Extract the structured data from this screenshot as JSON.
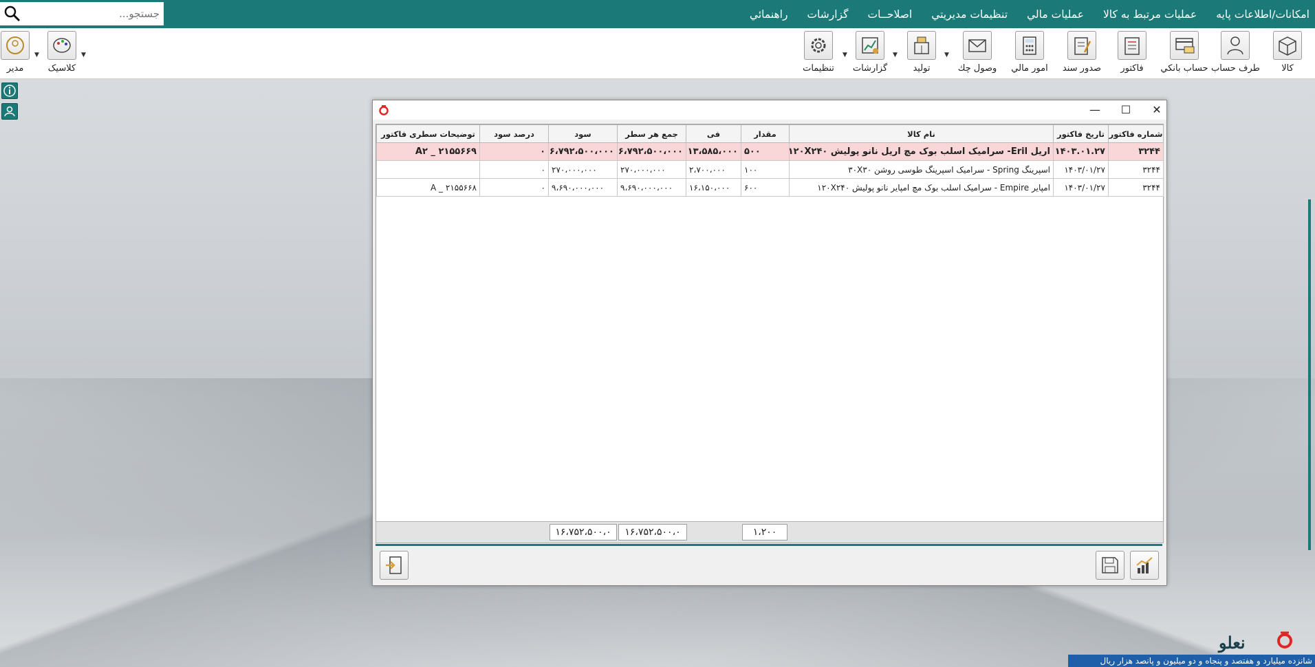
{
  "menu": {
    "items": [
      "امکانات/اطلاعات پایه",
      "عملیات مرتبط به کالا",
      "عمليات مالي",
      "تنظيمات مديريتي",
      "اصلاحــات",
      "گزارشات",
      "راهنمائي"
    ],
    "search_placeholder": "جستجو..."
  },
  "toolbar": {
    "items": [
      "کالا",
      "طرف حساب",
      "حساب بانکي",
      "فاکتور",
      "صدور سند",
      "امور مالي",
      "وصول چك",
      "توليد",
      "گزارشات",
      "تنظيمات"
    ],
    "right_items": [
      "کلاسیک",
      "مدیر"
    ]
  },
  "window": {
    "columns": [
      "شماره فاکتور",
      "تاريخ فاکتور",
      "نام کالا",
      "مقدار",
      "فی",
      "جمع هر سطر",
      "سود",
      "درصد سود",
      "توضیحات سطری فاکتور"
    ],
    "rows": [
      [
        "۳۲۴۴",
        "۱۴۰۳.۰۱.۲۷",
        "اریل Eril- سرامیک اسلب بوک مچ اریل نانو پولیش ۱۲۰X۲۴۰",
        "۵۰۰",
        "۱۳،۵۸۵،۰۰۰",
        "۶،۷۹۲،۵۰۰،۰۰۰",
        "۶،۷۹۲،۵۰۰،۰۰۰",
        "۰",
        "۲۱۵۵۶۶۹ _ A۲"
      ],
      [
        "۳۲۴۴",
        "۱۴۰۳/۰۱/۲۷",
        "اسپرینگ Spring - سرامیک اسپرینگ طوسی روشن ۳۰X۳۰",
        "۱۰۰",
        "۲،۷۰۰،۰۰۰",
        "۲۷۰،۰۰۰،۰۰۰",
        "۲۷۰،۰۰۰،۰۰۰",
        "۰",
        ""
      ],
      [
        "۳۲۴۴",
        "۱۴۰۳/۰۱/۲۷",
        "امپایر Empire - سرامیک اسلب بوک مچ امپایر نانو پولیش ۱۲۰X۲۴۰",
        "۶۰۰",
        "۱۶،۱۵۰،۰۰۰",
        "۹،۶۹۰،۰۰۰،۰۰۰",
        "۹،۶۹۰،۰۰۰،۰۰۰",
        "۰",
        "۲۱۵۵۶۶۸ _ A"
      ]
    ],
    "footer": {
      "qty_total": "۱،۲۰۰",
      "row_sum_total": "۱۶،۷۵۲،۵۰۰،۰",
      "profit_total": "۱۶،۷۵۲،۵۰۰،۰"
    }
  },
  "status_text": "شانزده ميليارد  و هفتصد و پنجاه و دو ميليون  و پانصد هزار  ريال",
  "logo_text": "نعلو",
  "colors": {
    "teal": "#1b7a78",
    "selected_row": "#f9d7d9",
    "status_blue": "#1f5ea8",
    "logo_red": "#e02525"
  }
}
